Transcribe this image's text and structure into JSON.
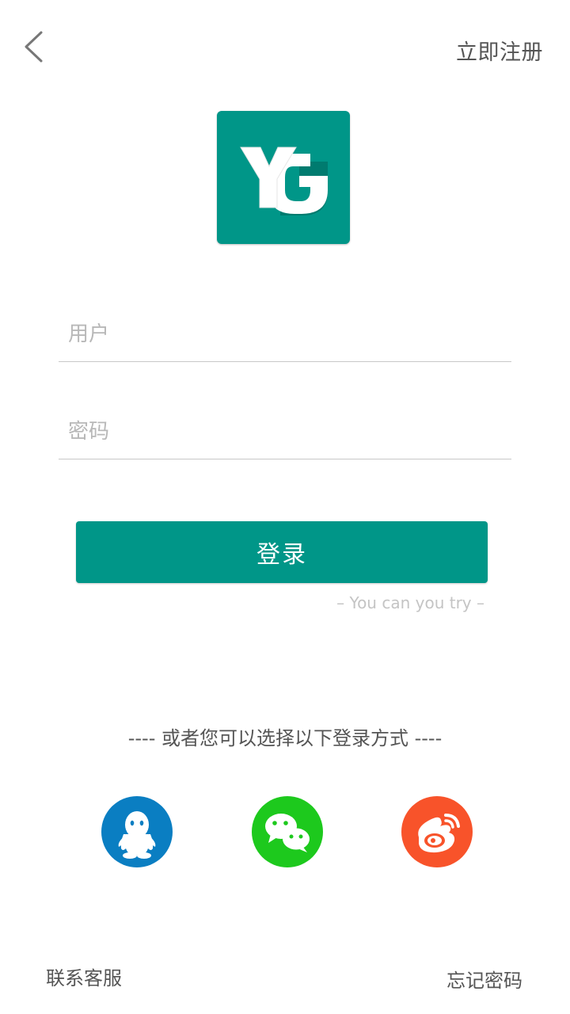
{
  "header": {
    "back_icon": "chevron-left-icon",
    "register_label": "立即注册"
  },
  "logo": {
    "text": "YG",
    "background": "#009688"
  },
  "form": {
    "username_placeholder": "用户",
    "password_placeholder": "密码",
    "login_label": "登录",
    "tagline": "– You can you try –"
  },
  "alternative": {
    "title": "---- 或者您可以选择以下登录方式 ----",
    "providers": [
      {
        "name": "qq-icon",
        "color": "#0a7ec2"
      },
      {
        "name": "wechat-icon",
        "color": "#1dc91d"
      },
      {
        "name": "weibo-icon",
        "color": "#f8532a"
      }
    ]
  },
  "footer": {
    "contact_label": "联系客服",
    "forgot_label": "忘记密码"
  },
  "colors": {
    "primary": "#009688",
    "text": "#555555",
    "placeholder": "#b8b8b8",
    "divider": "#c8c8c8"
  }
}
